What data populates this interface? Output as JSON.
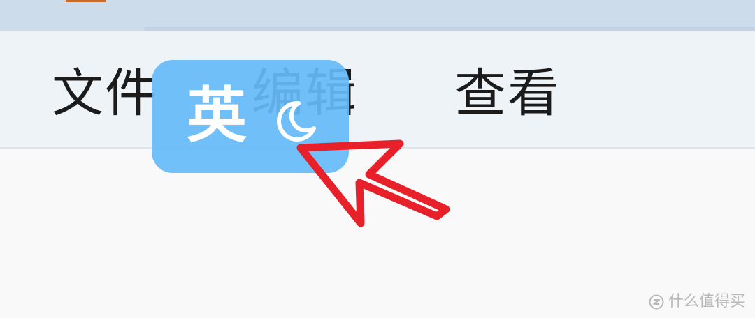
{
  "menubar": {
    "items": [
      {
        "label": "文件"
      },
      {
        "label": "编辑"
      },
      {
        "label": "查看"
      }
    ]
  },
  "ime": {
    "mode_char": "英",
    "mode_icon": "moon-icon"
  },
  "annotation": {
    "icon": "red-arrow-icon",
    "color": "#e8202a"
  },
  "watermark": {
    "text": "什么值得买"
  },
  "colors": {
    "titlebar": "#cddcea",
    "menubar": "#eef3f8",
    "ime_badge": "#66bbf8"
  }
}
